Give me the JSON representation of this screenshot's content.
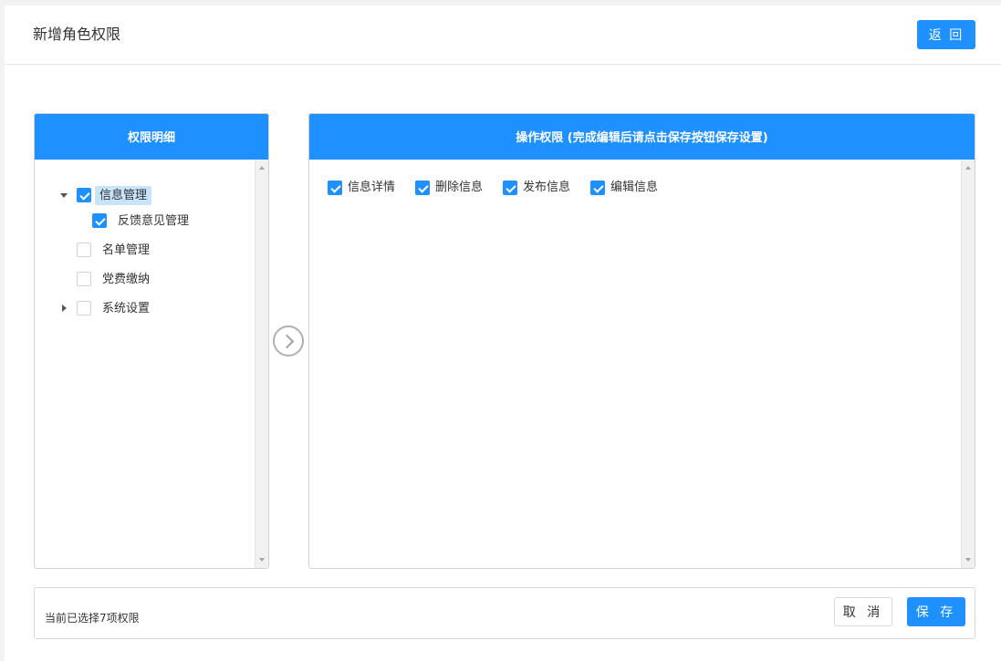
{
  "header": {
    "title": "新增角色权限",
    "back_label": "返 回"
  },
  "left_panel": {
    "title": "权限明细",
    "tree": [
      {
        "label": "信息管理",
        "checked": true,
        "expand": "down",
        "highlight": true
      },
      {
        "label": "反馈意见管理",
        "checked": true,
        "expand": "none"
      },
      {
        "label": "名单管理",
        "checked": false,
        "expand": "none"
      },
      {
        "label": "党费缴纳",
        "checked": false,
        "expand": "none"
      },
      {
        "label": "系统设置",
        "checked": false,
        "expand": "right"
      }
    ]
  },
  "right_panel": {
    "title": "操作权限 (完成编辑后请点击保存按钮保存设置)",
    "permissions": [
      {
        "label": "信息详情",
        "checked": true
      },
      {
        "label": "删除信息",
        "checked": true
      },
      {
        "label": "发布信息",
        "checked": true
      },
      {
        "label": "编辑信息",
        "checked": true
      }
    ]
  },
  "footer": {
    "status_text": "当前已选择7项权限",
    "cancel_label": "取 消",
    "save_label": "保 存"
  },
  "colors": {
    "primary": "#1e90ff",
    "highlight": "#c7e4fb",
    "border": "#d2d2d2"
  },
  "icons": {
    "transfer": "chevron-right-circle-icon",
    "check": "checkmark-icon"
  }
}
